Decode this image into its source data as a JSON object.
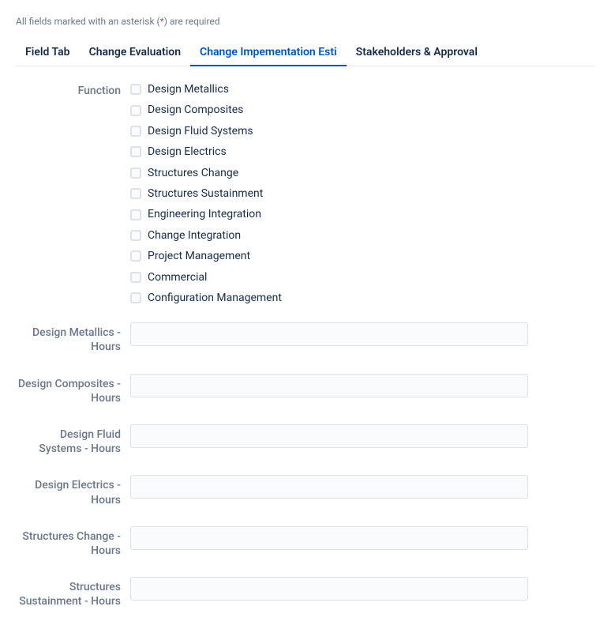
{
  "helper_text": "All fields marked with an asterisk (*) are required",
  "tabs": [
    {
      "label": "Field Tab",
      "active": false
    },
    {
      "label": "Change Evaluation",
      "active": false
    },
    {
      "label": "Change Impementation Esti",
      "active": true
    },
    {
      "label": "Stakeholders & Approval",
      "active": false
    }
  ],
  "function_field": {
    "label": "Function",
    "options": [
      "Design Metallics",
      "Design Composites",
      "Design Fluid Systems",
      "Design Electrics",
      "Structures Change",
      "Structures Sustainment",
      "Engineering Integration",
      "Change Integration",
      "Project Management",
      "Commercial",
      "Configuration Management"
    ]
  },
  "hour_fields": [
    {
      "label": "Design Metallics - Hours",
      "value": ""
    },
    {
      "label": "Design Composites - Hours",
      "value": ""
    },
    {
      "label": "Design Fluid Systems - Hours",
      "value": ""
    },
    {
      "label": "Design Electrics - Hours",
      "value": ""
    },
    {
      "label": "Structures Change - Hours",
      "value": ""
    },
    {
      "label": "Structures Sustainment - Hours",
      "value": ""
    }
  ]
}
